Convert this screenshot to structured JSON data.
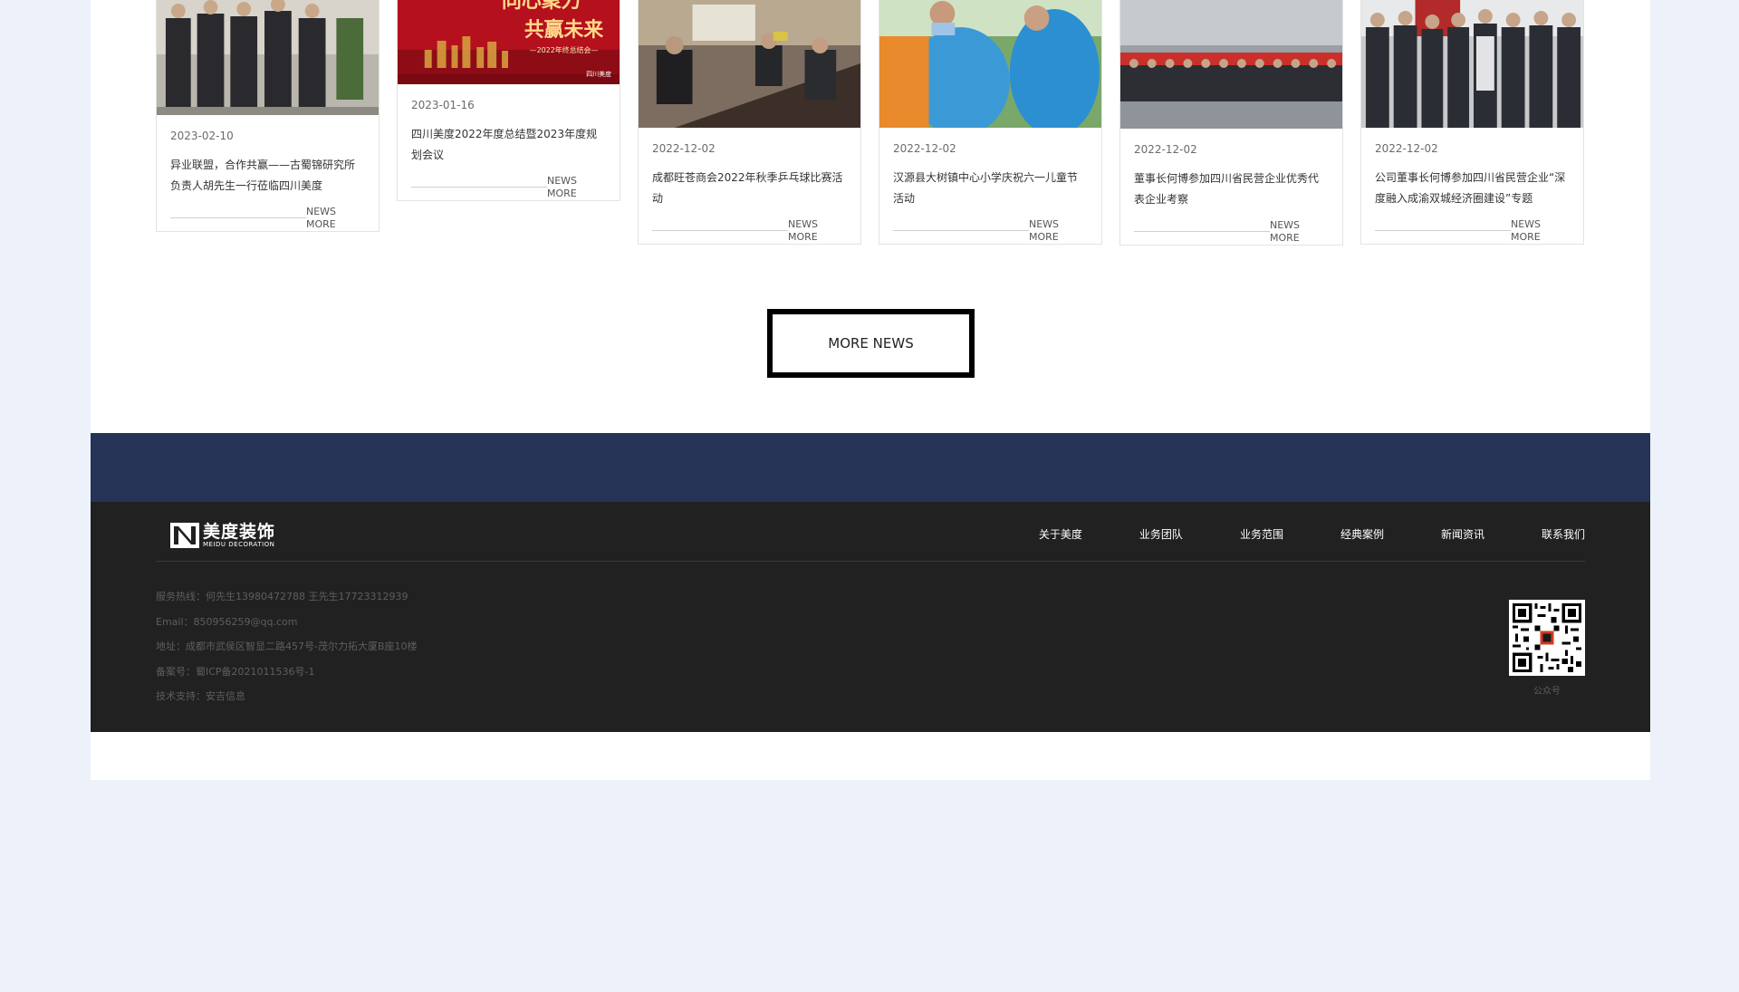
{
  "news": [
    {
      "date": "2023-02-10",
      "title": "异业联盟，合作共赢——古蜀锦研究所负责人胡先生一行莅临四川美度",
      "more": [
        "NEWS",
        "MORE"
      ]
    },
    {
      "date": "2023-01-16",
      "title": "四川美度2022年度总结暨2023年度规划会议",
      "more": [
        "NEWS",
        "MORE"
      ],
      "image_text": {
        "line1": "同心聚力",
        "line2": "共赢未来",
        "line3": "—2022年终总结会—",
        "brand": "四川美度"
      }
    },
    {
      "date": "2022-12-02",
      "title": "成都旺苍商会2022年秋季乒乓球比赛活动",
      "more": [
        "NEWS",
        "MORE"
      ]
    },
    {
      "date": "2022-12-02",
      "title": "汉源县大树镇中心小学庆祝六一儿童节活动",
      "more": [
        "NEWS",
        "MORE"
      ]
    },
    {
      "date": "2022-12-02",
      "title": "董事长何博参加四川省民营企业优秀代表企业考察",
      "more": [
        "NEWS",
        "MORE"
      ]
    },
    {
      "date": "2022-12-02",
      "title": "公司董事长何博参加四川省民营企业“深度融入成渝双城经济圈建设”专题",
      "more": [
        "NEWS",
        "MORE"
      ]
    }
  ],
  "more_news_label": "MORE NEWS",
  "footer": {
    "logo": {
      "cn": "美度装饰",
      "en": "MEIDU DECORATION"
    },
    "nav": [
      "关于美度",
      "业务团队",
      "业务范围",
      "经典案例",
      "新闻资讯",
      "联系我们"
    ],
    "info": [
      "服务热线：何先生13980472788 王先生17723312939",
      "Email：850956259@qq.com",
      "地址：成都市武侯区智显二路457号-茂尔力拓大厦B座10楼",
      "备案号：蜀ICP备2021011536号-1",
      "技术支持：安吉信息"
    ],
    "qr_label": "公众号"
  },
  "colors": {
    "page_bg": "#edf2fa",
    "band": "#253356",
    "footer": "#212121"
  }
}
